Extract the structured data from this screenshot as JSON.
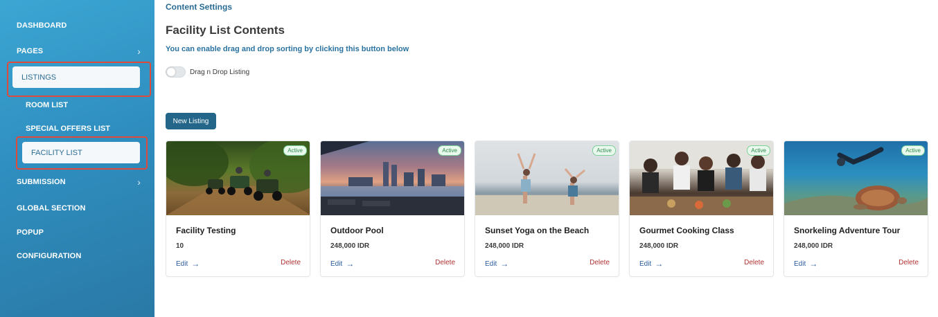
{
  "sidebar": {
    "dashboard": "DASHBOARD",
    "pages": "PAGES",
    "listings": "LISTINGS",
    "room_list": "ROOM LIST",
    "special_offers_list": "SPECIAL OFFERS LIST",
    "facility_list": "FACILITY LIST",
    "submission": "SUBMISSION",
    "global_section": "GLOBAL SECTION",
    "popup": "POPUP",
    "configuration": "CONFIGURATION",
    "chevron_icon": "chevron-right-icon"
  },
  "main": {
    "breadcrumb": "Content Settings",
    "title": "Facility List Contents",
    "hint": "You can enable drag and drop sorting by clicking this button below",
    "toggle_label": "Drag n Drop Listing",
    "toggle_on": false,
    "new_listing_label": "New Listing"
  },
  "cards": [
    {
      "title": "Facility Testing",
      "price": "10",
      "status": "Active",
      "edit": "Edit",
      "delete": "Delete",
      "image": "atv-jungle"
    },
    {
      "title": "Outdoor Pool",
      "price": "248,000 IDR",
      "status": "Active",
      "edit": "Edit",
      "delete": "Delete",
      "image": "rooftop-pool-skyline"
    },
    {
      "title": "Sunset Yoga on the Beach",
      "price": "248,000 IDR",
      "status": "Active",
      "edit": "Edit",
      "delete": "Delete",
      "image": "beach-yoga"
    },
    {
      "title": "Gourmet Cooking Class",
      "price": "248,000 IDR",
      "status": "Active",
      "edit": "Edit",
      "delete": "Delete",
      "image": "cooking-class"
    },
    {
      "title": "Snorkeling Adventure Tour",
      "price": "248,000 IDR",
      "status": "Active",
      "edit": "Edit",
      "delete": "Delete",
      "image": "snorkel-turtle"
    }
  ],
  "colors": {
    "accent": "#236689",
    "highlight_border": "#e04a3a",
    "active_badge": "#2f8a4a",
    "delete": "#b03030"
  }
}
